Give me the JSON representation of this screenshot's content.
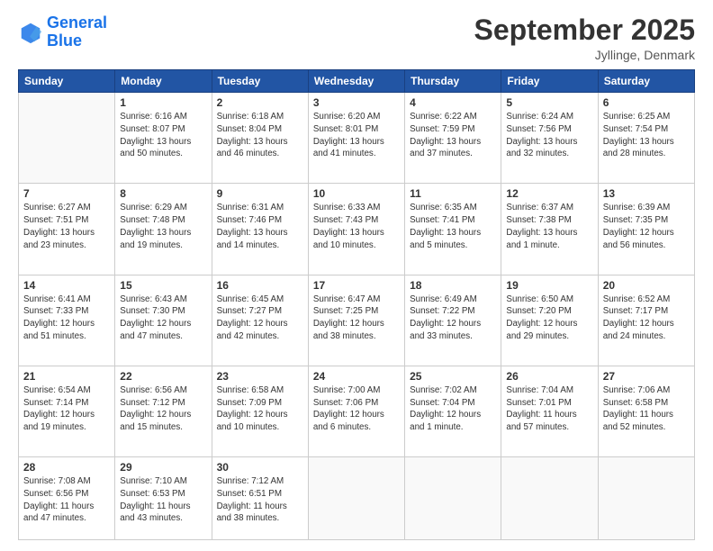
{
  "logo": {
    "line1": "General",
    "line2": "Blue"
  },
  "header": {
    "title": "September 2025",
    "location": "Jyllinge, Denmark"
  },
  "weekdays": [
    "Sunday",
    "Monday",
    "Tuesday",
    "Wednesday",
    "Thursday",
    "Friday",
    "Saturday"
  ],
  "weeks": [
    [
      {
        "day": "",
        "info": ""
      },
      {
        "day": "1",
        "info": "Sunrise: 6:16 AM\nSunset: 8:07 PM\nDaylight: 13 hours\nand 50 minutes."
      },
      {
        "day": "2",
        "info": "Sunrise: 6:18 AM\nSunset: 8:04 PM\nDaylight: 13 hours\nand 46 minutes."
      },
      {
        "day": "3",
        "info": "Sunrise: 6:20 AM\nSunset: 8:01 PM\nDaylight: 13 hours\nand 41 minutes."
      },
      {
        "day": "4",
        "info": "Sunrise: 6:22 AM\nSunset: 7:59 PM\nDaylight: 13 hours\nand 37 minutes."
      },
      {
        "day": "5",
        "info": "Sunrise: 6:24 AM\nSunset: 7:56 PM\nDaylight: 13 hours\nand 32 minutes."
      },
      {
        "day": "6",
        "info": "Sunrise: 6:25 AM\nSunset: 7:54 PM\nDaylight: 13 hours\nand 28 minutes."
      }
    ],
    [
      {
        "day": "7",
        "info": "Sunrise: 6:27 AM\nSunset: 7:51 PM\nDaylight: 13 hours\nand 23 minutes."
      },
      {
        "day": "8",
        "info": "Sunrise: 6:29 AM\nSunset: 7:48 PM\nDaylight: 13 hours\nand 19 minutes."
      },
      {
        "day": "9",
        "info": "Sunrise: 6:31 AM\nSunset: 7:46 PM\nDaylight: 13 hours\nand 14 minutes."
      },
      {
        "day": "10",
        "info": "Sunrise: 6:33 AM\nSunset: 7:43 PM\nDaylight: 13 hours\nand 10 minutes."
      },
      {
        "day": "11",
        "info": "Sunrise: 6:35 AM\nSunset: 7:41 PM\nDaylight: 13 hours\nand 5 minutes."
      },
      {
        "day": "12",
        "info": "Sunrise: 6:37 AM\nSunset: 7:38 PM\nDaylight: 13 hours\nand 1 minute."
      },
      {
        "day": "13",
        "info": "Sunrise: 6:39 AM\nSunset: 7:35 PM\nDaylight: 12 hours\nand 56 minutes."
      }
    ],
    [
      {
        "day": "14",
        "info": "Sunrise: 6:41 AM\nSunset: 7:33 PM\nDaylight: 12 hours\nand 51 minutes."
      },
      {
        "day": "15",
        "info": "Sunrise: 6:43 AM\nSunset: 7:30 PM\nDaylight: 12 hours\nand 47 minutes."
      },
      {
        "day": "16",
        "info": "Sunrise: 6:45 AM\nSunset: 7:27 PM\nDaylight: 12 hours\nand 42 minutes."
      },
      {
        "day": "17",
        "info": "Sunrise: 6:47 AM\nSunset: 7:25 PM\nDaylight: 12 hours\nand 38 minutes."
      },
      {
        "day": "18",
        "info": "Sunrise: 6:49 AM\nSunset: 7:22 PM\nDaylight: 12 hours\nand 33 minutes."
      },
      {
        "day": "19",
        "info": "Sunrise: 6:50 AM\nSunset: 7:20 PM\nDaylight: 12 hours\nand 29 minutes."
      },
      {
        "day": "20",
        "info": "Sunrise: 6:52 AM\nSunset: 7:17 PM\nDaylight: 12 hours\nand 24 minutes."
      }
    ],
    [
      {
        "day": "21",
        "info": "Sunrise: 6:54 AM\nSunset: 7:14 PM\nDaylight: 12 hours\nand 19 minutes."
      },
      {
        "day": "22",
        "info": "Sunrise: 6:56 AM\nSunset: 7:12 PM\nDaylight: 12 hours\nand 15 minutes."
      },
      {
        "day": "23",
        "info": "Sunrise: 6:58 AM\nSunset: 7:09 PM\nDaylight: 12 hours\nand 10 minutes."
      },
      {
        "day": "24",
        "info": "Sunrise: 7:00 AM\nSunset: 7:06 PM\nDaylight: 12 hours\nand 6 minutes."
      },
      {
        "day": "25",
        "info": "Sunrise: 7:02 AM\nSunset: 7:04 PM\nDaylight: 12 hours\nand 1 minute."
      },
      {
        "day": "26",
        "info": "Sunrise: 7:04 AM\nSunset: 7:01 PM\nDaylight: 11 hours\nand 57 minutes."
      },
      {
        "day": "27",
        "info": "Sunrise: 7:06 AM\nSunset: 6:58 PM\nDaylight: 11 hours\nand 52 minutes."
      }
    ],
    [
      {
        "day": "28",
        "info": "Sunrise: 7:08 AM\nSunset: 6:56 PM\nDaylight: 11 hours\nand 47 minutes."
      },
      {
        "day": "29",
        "info": "Sunrise: 7:10 AM\nSunset: 6:53 PM\nDaylight: 11 hours\nand 43 minutes."
      },
      {
        "day": "30",
        "info": "Sunrise: 7:12 AM\nSunset: 6:51 PM\nDaylight: 11 hours\nand 38 minutes."
      },
      {
        "day": "",
        "info": ""
      },
      {
        "day": "",
        "info": ""
      },
      {
        "day": "",
        "info": ""
      },
      {
        "day": "",
        "info": ""
      }
    ]
  ]
}
